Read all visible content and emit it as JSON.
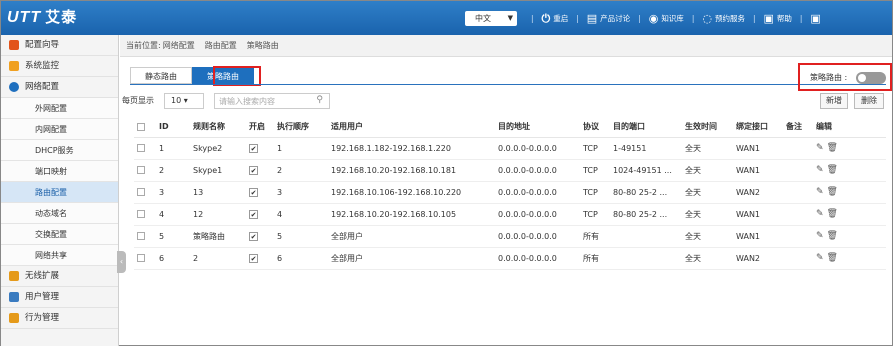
{
  "brand": {
    "logo_text": "UTT",
    "logo_cn": "艾泰"
  },
  "topnav": {
    "language": "中文",
    "items": [
      {
        "icon": "power-icon",
        "label": "重启"
      },
      {
        "icon": "chat-icon",
        "label": "产品讨论"
      },
      {
        "icon": "knowledge-icon",
        "label": "知识库"
      },
      {
        "icon": "service-icon",
        "label": "预约服务"
      },
      {
        "icon": "help-icon",
        "label": "帮助"
      }
    ]
  },
  "sidebar": {
    "items": [
      {
        "label": "配置向导",
        "color": "#e2541b"
      },
      {
        "label": "系统监控",
        "color": "#f0a020"
      },
      {
        "label": "网络配置",
        "color": "#1e6fbe"
      }
    ],
    "subitems": [
      "外网配置",
      "内网配置",
      "DHCP服务",
      "端口映射",
      "路由配置",
      "动态域名",
      "交换配置",
      "网络共享"
    ],
    "active_sub": 4,
    "more": [
      {
        "label": "无线扩展",
        "color": "#e59a1a"
      },
      {
        "label": "用户管理",
        "color": "#3a7bc0"
      },
      {
        "label": "行为管理",
        "color": "#e59a1a"
      }
    ]
  },
  "breadcrumb": {
    "prefix": "当前位置:",
    "l1": "网络配置",
    "l2": "路由配置",
    "l3": "策略路由"
  },
  "tabs": [
    "静态路由",
    "策略路由"
  ],
  "switch": {
    "label": "策略路由 :",
    "state": "off"
  },
  "toolbar": {
    "per_page_label": "每页显示",
    "per_page": "10",
    "search_placeholder": "请输入搜索内容",
    "add_label": "新增",
    "delete_label": "删除"
  },
  "table": {
    "headers": [
      "ID",
      "规则名称",
      "开启",
      "执行顺序",
      "适用用户",
      "目的地址",
      "协议",
      "目的端口",
      "生效时间",
      "绑定接口",
      "备注",
      "编辑"
    ],
    "rows": [
      {
        "id": "1",
        "name": "Skype2",
        "order": "1",
        "users": "192.168.1.182-192.168.1.220",
        "dest": "0.0.0.0-0.0.0.0",
        "proto": "TCP",
        "port": "1-49151",
        "time": "全天",
        "iface": "WAN1",
        "note": ""
      },
      {
        "id": "2",
        "name": "Skype1",
        "order": "2",
        "users": "192.168.10.20-192.168.10.181",
        "dest": "0.0.0.0-0.0.0.0",
        "proto": "TCP",
        "port": "1024-49151 ...",
        "time": "全天",
        "iface": "WAN1",
        "note": ""
      },
      {
        "id": "3",
        "name": "13",
        "order": "3",
        "users": "192.168.10.106-192.168.10.220",
        "dest": "0.0.0.0-0.0.0.0",
        "proto": "TCP",
        "port": "80-80 25-2 ...",
        "time": "全天",
        "iface": "WAN2",
        "note": ""
      },
      {
        "id": "4",
        "name": "12",
        "order": "4",
        "users": "192.168.10.20-192.168.10.105",
        "dest": "0.0.0.0-0.0.0.0",
        "proto": "TCP",
        "port": "80-80 25-2 ...",
        "time": "全天",
        "iface": "WAN1",
        "note": ""
      },
      {
        "id": "5",
        "name": "策略路由",
        "order": "5",
        "users": "全部用户",
        "dest": "0.0.0.0-0.0.0.0",
        "proto": "所有",
        "port": "",
        "time": "全天",
        "iface": "WAN1",
        "note": ""
      },
      {
        "id": "6",
        "name": "2",
        "order": "6",
        "users": "全部用户",
        "dest": "0.0.0.0-0.0.0.0",
        "proto": "所有",
        "port": "",
        "time": "全天",
        "iface": "WAN2",
        "note": ""
      }
    ]
  }
}
